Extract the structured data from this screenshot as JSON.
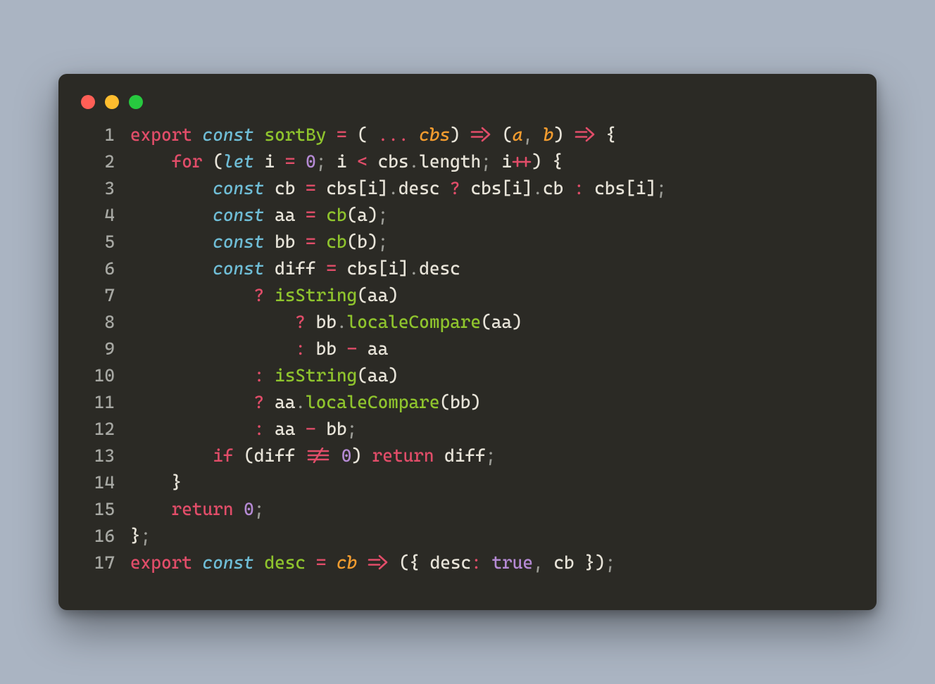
{
  "window": {
    "traffic_lights": [
      "red",
      "yellow",
      "green"
    ]
  },
  "colors": {
    "bg_outer": "#aab4c2",
    "bg_window": "#2b2a25",
    "gutter": "#a7a8a3",
    "text": "#e8e4d9",
    "keyword_red": "#e14d69",
    "keyword_blue_italic": "#6fbdd6",
    "function_green": "#8fc42d",
    "operator": "#e14d69",
    "punct": "#9c9d97",
    "param_orange_italic": "#f39c2f",
    "number_purple": "#b58ad4"
  },
  "code": {
    "language": "javascript",
    "tab": "    ",
    "lines": [
      {
        "n": 1,
        "segments": [
          {
            "c": "kw1",
            "t": "export"
          },
          {
            "c": "tx",
            "t": " "
          },
          {
            "c": "kw2",
            "t": "const"
          },
          {
            "c": "tx",
            "t": " "
          },
          {
            "c": "fn",
            "t": "sortBy"
          },
          {
            "c": "tx",
            "t": " "
          },
          {
            "c": "op",
            "t": "="
          },
          {
            "c": "tx",
            "t": " ("
          },
          {
            "c": "op",
            "t": " ... "
          },
          {
            "c": "pa",
            "t": "cbs"
          },
          {
            "c": "tx",
            "t": ") "
          },
          {
            "c": "op",
            "glyph": "fat-arrow"
          },
          {
            "c": "tx",
            "t": " ("
          },
          {
            "c": "pa",
            "t": "a"
          },
          {
            "c": "pu",
            "t": ", "
          },
          {
            "c": "pa",
            "t": "b"
          },
          {
            "c": "tx",
            "t": ") "
          },
          {
            "c": "op",
            "glyph": "fat-arrow"
          },
          {
            "c": "tx",
            "t": " {"
          }
        ]
      },
      {
        "n": 2,
        "segments": [
          {
            "c": "tx",
            "t": "    "
          },
          {
            "c": "kw1",
            "t": "for"
          },
          {
            "c": "tx",
            "t": " ("
          },
          {
            "c": "kw2",
            "t": "let"
          },
          {
            "c": "tx",
            "t": " i "
          },
          {
            "c": "op",
            "t": "="
          },
          {
            "c": "tx",
            "t": " "
          },
          {
            "c": "nu",
            "t": "0"
          },
          {
            "c": "pu",
            "t": ";"
          },
          {
            "c": "tx",
            "t": " i "
          },
          {
            "c": "op",
            "t": "<"
          },
          {
            "c": "tx",
            "t": " cbs"
          },
          {
            "c": "pu",
            "t": "."
          },
          {
            "c": "tx",
            "t": "length"
          },
          {
            "c": "pu",
            "t": ";"
          },
          {
            "c": "tx",
            "t": " i"
          },
          {
            "c": "op",
            "glyph": "plus-plus"
          },
          {
            "c": "tx",
            "t": ") {"
          }
        ]
      },
      {
        "n": 3,
        "segments": [
          {
            "c": "tx",
            "t": "        "
          },
          {
            "c": "kw2",
            "t": "const"
          },
          {
            "c": "tx",
            "t": " cb "
          },
          {
            "c": "op",
            "t": "="
          },
          {
            "c": "tx",
            "t": " cbs[i]"
          },
          {
            "c": "pu",
            "t": "."
          },
          {
            "c": "tx",
            "t": "desc "
          },
          {
            "c": "op",
            "t": "?"
          },
          {
            "c": "tx",
            "t": " cbs[i]"
          },
          {
            "c": "pu",
            "t": "."
          },
          {
            "c": "tx",
            "t": "cb "
          },
          {
            "c": "op",
            "t": ":"
          },
          {
            "c": "tx",
            "t": " cbs[i]"
          },
          {
            "c": "pu",
            "t": ";"
          }
        ]
      },
      {
        "n": 4,
        "segments": [
          {
            "c": "tx",
            "t": "        "
          },
          {
            "c": "kw2",
            "t": "const"
          },
          {
            "c": "tx",
            "t": " aa "
          },
          {
            "c": "op",
            "t": "="
          },
          {
            "c": "tx",
            "t": " "
          },
          {
            "c": "fn",
            "t": "cb"
          },
          {
            "c": "tx",
            "t": "(a)"
          },
          {
            "c": "pu",
            "t": ";"
          }
        ]
      },
      {
        "n": 5,
        "segments": [
          {
            "c": "tx",
            "t": "        "
          },
          {
            "c": "kw2",
            "t": "const"
          },
          {
            "c": "tx",
            "t": " bb "
          },
          {
            "c": "op",
            "t": "="
          },
          {
            "c": "tx",
            "t": " "
          },
          {
            "c": "fn",
            "t": "cb"
          },
          {
            "c": "tx",
            "t": "(b)"
          },
          {
            "c": "pu",
            "t": ";"
          }
        ]
      },
      {
        "n": 6,
        "segments": [
          {
            "c": "tx",
            "t": "        "
          },
          {
            "c": "kw2",
            "t": "const"
          },
          {
            "c": "tx",
            "t": " diff "
          },
          {
            "c": "op",
            "t": "="
          },
          {
            "c": "tx",
            "t": " cbs[i]"
          },
          {
            "c": "pu",
            "t": "."
          },
          {
            "c": "tx",
            "t": "desc"
          }
        ]
      },
      {
        "n": 7,
        "segments": [
          {
            "c": "tx",
            "t": "            "
          },
          {
            "c": "op",
            "t": "?"
          },
          {
            "c": "tx",
            "t": " "
          },
          {
            "c": "fn",
            "t": "isString"
          },
          {
            "c": "tx",
            "t": "(aa)"
          }
        ]
      },
      {
        "n": 8,
        "segments": [
          {
            "c": "tx",
            "t": "                "
          },
          {
            "c": "op",
            "t": "?"
          },
          {
            "c": "tx",
            "t": " bb"
          },
          {
            "c": "pu",
            "t": "."
          },
          {
            "c": "fn",
            "t": "localeCompare"
          },
          {
            "c": "tx",
            "t": "(aa)"
          }
        ]
      },
      {
        "n": 9,
        "segments": [
          {
            "c": "tx",
            "t": "                "
          },
          {
            "c": "op",
            "t": ":"
          },
          {
            "c": "tx",
            "t": " bb "
          },
          {
            "c": "op",
            "t": "-"
          },
          {
            "c": "tx",
            "t": " aa"
          }
        ]
      },
      {
        "n": 10,
        "segments": [
          {
            "c": "tx",
            "t": "            "
          },
          {
            "c": "op",
            "t": ":"
          },
          {
            "c": "tx",
            "t": " "
          },
          {
            "c": "fn",
            "t": "isString"
          },
          {
            "c": "tx",
            "t": "(aa)"
          }
        ]
      },
      {
        "n": 11,
        "segments": [
          {
            "c": "tx",
            "t": "            "
          },
          {
            "c": "op",
            "t": "?"
          },
          {
            "c": "tx",
            "t": " aa"
          },
          {
            "c": "pu",
            "t": "."
          },
          {
            "c": "fn",
            "t": "localeCompare"
          },
          {
            "c": "tx",
            "t": "(bb)"
          }
        ]
      },
      {
        "n": 12,
        "segments": [
          {
            "c": "tx",
            "t": "            "
          },
          {
            "c": "op",
            "t": ":"
          },
          {
            "c": "tx",
            "t": " aa "
          },
          {
            "c": "op",
            "t": "-"
          },
          {
            "c": "tx",
            "t": " bb"
          },
          {
            "c": "pu",
            "t": ";"
          }
        ]
      },
      {
        "n": 13,
        "segments": [
          {
            "c": "tx",
            "t": "        "
          },
          {
            "c": "kw1",
            "t": "if"
          },
          {
            "c": "tx",
            "t": " (diff "
          },
          {
            "c": "op",
            "glyph": "not-eq-eq"
          },
          {
            "c": "tx",
            "t": " "
          },
          {
            "c": "nu",
            "t": "0"
          },
          {
            "c": "tx",
            "t": ") "
          },
          {
            "c": "kw1",
            "t": "return"
          },
          {
            "c": "tx",
            "t": " diff"
          },
          {
            "c": "pu",
            "t": ";"
          }
        ]
      },
      {
        "n": 14,
        "segments": [
          {
            "c": "tx",
            "t": "    }"
          }
        ]
      },
      {
        "n": 15,
        "segments": [
          {
            "c": "tx",
            "t": "    "
          },
          {
            "c": "kw1",
            "t": "return"
          },
          {
            "c": "tx",
            "t": " "
          },
          {
            "c": "nu",
            "t": "0"
          },
          {
            "c": "pu",
            "t": ";"
          }
        ]
      },
      {
        "n": 16,
        "segments": [
          {
            "c": "tx",
            "t": "}"
          },
          {
            "c": "pu",
            "t": ";"
          }
        ]
      },
      {
        "n": 17,
        "segments": [
          {
            "c": "kw1",
            "t": "export"
          },
          {
            "c": "tx",
            "t": " "
          },
          {
            "c": "kw2",
            "t": "const"
          },
          {
            "c": "tx",
            "t": " "
          },
          {
            "c": "fn",
            "t": "desc"
          },
          {
            "c": "tx",
            "t": " "
          },
          {
            "c": "op",
            "t": "="
          },
          {
            "c": "tx",
            "t": " "
          },
          {
            "c": "pa",
            "t": "cb"
          },
          {
            "c": "tx",
            "t": " "
          },
          {
            "c": "op",
            "glyph": "fat-arrow"
          },
          {
            "c": "tx",
            "t": " ({ desc"
          },
          {
            "c": "op",
            "t": ":"
          },
          {
            "c": "tx",
            "t": " "
          },
          {
            "c": "nu",
            "t": "true"
          },
          {
            "c": "pu",
            "t": ","
          },
          {
            "c": "tx",
            "t": " cb })"
          },
          {
            "c": "pu",
            "t": ";"
          }
        ]
      }
    ]
  }
}
